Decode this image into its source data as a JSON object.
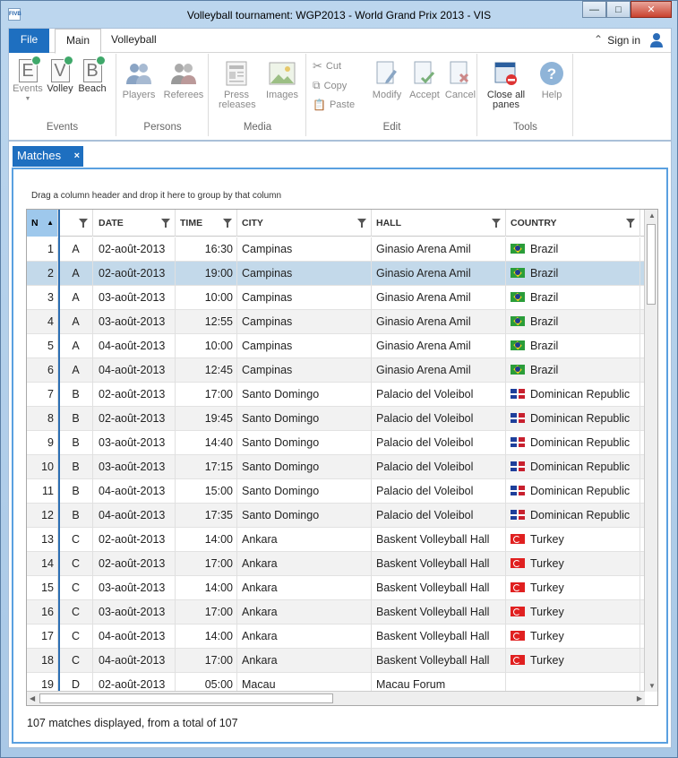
{
  "window": {
    "title": "Volleyball tournament: WGP2013 - World Grand Prix 2013  - VIS",
    "app_icon": "FIVB"
  },
  "ribbon": {
    "tabs": {
      "file": "File",
      "main": "Main",
      "volleyball": "Volleyball"
    },
    "sign_in": "Sign in",
    "groups": {
      "events": {
        "label": "Events",
        "buttons": [
          "Events",
          "Volley",
          "Beach"
        ]
      },
      "persons": {
        "label": "Persons",
        "buttons": [
          "Players",
          "Referees"
        ]
      },
      "media": {
        "label": "Media",
        "buttons": [
          "Press releases",
          "Images"
        ]
      },
      "edit": {
        "label": "Edit",
        "small": [
          "Cut",
          "Copy",
          "Paste"
        ],
        "buttons": [
          "Modify",
          "Accept",
          "Cancel"
        ]
      },
      "tools": {
        "label": "Tools",
        "buttons": [
          "Close all panes",
          "Help"
        ]
      }
    }
  },
  "panel": {
    "tab_label": "Matches",
    "group_hint": "Drag a column header and drop it here to group by that column",
    "status": "107 matches displayed, from a total of 107"
  },
  "grid": {
    "columns": [
      "N",
      "",
      "DATE",
      "TIME",
      "CITY",
      "HALL",
      "COUNTRY"
    ],
    "rows": [
      {
        "n": "1",
        "pool": "A",
        "date": "02-août-2013",
        "time": "16:30",
        "city": "Campinas",
        "hall": "Ginasio Arena Amil",
        "country": "Brazil",
        "flag": "br"
      },
      {
        "n": "2",
        "pool": "A",
        "date": "02-août-2013",
        "time": "19:00",
        "city": "Campinas",
        "hall": "Ginasio Arena Amil",
        "country": "Brazil",
        "flag": "br"
      },
      {
        "n": "3",
        "pool": "A",
        "date": "03-août-2013",
        "time": "10:00",
        "city": "Campinas",
        "hall": "Ginasio Arena Amil",
        "country": "Brazil",
        "flag": "br"
      },
      {
        "n": "4",
        "pool": "A",
        "date": "03-août-2013",
        "time": "12:55",
        "city": "Campinas",
        "hall": "Ginasio Arena Amil",
        "country": "Brazil",
        "flag": "br"
      },
      {
        "n": "5",
        "pool": "A",
        "date": "04-août-2013",
        "time": "10:00",
        "city": "Campinas",
        "hall": "Ginasio Arena Amil",
        "country": "Brazil",
        "flag": "br"
      },
      {
        "n": "6",
        "pool": "A",
        "date": "04-août-2013",
        "time": "12:45",
        "city": "Campinas",
        "hall": "Ginasio Arena Amil",
        "country": "Brazil",
        "flag": "br"
      },
      {
        "n": "7",
        "pool": "B",
        "date": "02-août-2013",
        "time": "17:00",
        "city": "Santo Domingo",
        "hall": "Palacio del Voleibol",
        "country": "Dominican Republic",
        "flag": "do"
      },
      {
        "n": "8",
        "pool": "B",
        "date": "02-août-2013",
        "time": "19:45",
        "city": "Santo Domingo",
        "hall": "Palacio del Voleibol",
        "country": "Dominican Republic",
        "flag": "do"
      },
      {
        "n": "9",
        "pool": "B",
        "date": "03-août-2013",
        "time": "14:40",
        "city": "Santo Domingo",
        "hall": "Palacio del Voleibol",
        "country": "Dominican Republic",
        "flag": "do"
      },
      {
        "n": "10",
        "pool": "B",
        "date": "03-août-2013",
        "time": "17:15",
        "city": "Santo Domingo",
        "hall": "Palacio del Voleibol",
        "country": "Dominican Republic",
        "flag": "do"
      },
      {
        "n": "11",
        "pool": "B",
        "date": "04-août-2013",
        "time": "15:00",
        "city": "Santo Domingo",
        "hall": "Palacio del Voleibol",
        "country": "Dominican Republic",
        "flag": "do"
      },
      {
        "n": "12",
        "pool": "B",
        "date": "04-août-2013",
        "time": "17:35",
        "city": "Santo Domingo",
        "hall": "Palacio del Voleibol",
        "country": "Dominican Republic",
        "flag": "do"
      },
      {
        "n": "13",
        "pool": "C",
        "date": "02-août-2013",
        "time": "14:00",
        "city": "Ankara",
        "hall": "Baskent Volleyball Hall",
        "country": "Turkey",
        "flag": "tr"
      },
      {
        "n": "14",
        "pool": "C",
        "date": "02-août-2013",
        "time": "17:00",
        "city": "Ankara",
        "hall": "Baskent Volleyball Hall",
        "country": "Turkey",
        "flag": "tr"
      },
      {
        "n": "15",
        "pool": "C",
        "date": "03-août-2013",
        "time": "14:00",
        "city": "Ankara",
        "hall": "Baskent Volleyball Hall",
        "country": "Turkey",
        "flag": "tr"
      },
      {
        "n": "16",
        "pool": "C",
        "date": "03-août-2013",
        "time": "17:00",
        "city": "Ankara",
        "hall": "Baskent Volleyball Hall",
        "country": "Turkey",
        "flag": "tr"
      },
      {
        "n": "17",
        "pool": "C",
        "date": "04-août-2013",
        "time": "14:00",
        "city": "Ankara",
        "hall": "Baskent Volleyball Hall",
        "country": "Turkey",
        "flag": "tr"
      },
      {
        "n": "18",
        "pool": "C",
        "date": "04-août-2013",
        "time": "17:00",
        "city": "Ankara",
        "hall": "Baskent Volleyball Hall",
        "country": "Turkey",
        "flag": "tr"
      },
      {
        "n": "19",
        "pool": "D",
        "date": "02-août-2013",
        "time": "05:00",
        "city": "Macau",
        "hall": "Macau Forum",
        "country": "",
        "flag": ""
      }
    ],
    "selected_row": "2"
  }
}
